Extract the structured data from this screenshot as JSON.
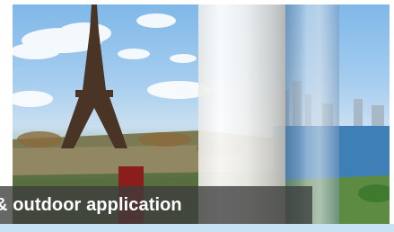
{
  "banner": {
    "caption": "& outdoor application",
    "photo_subject": "eiffel-tower-and-city-skyline-page-curl",
    "colors": {
      "caption_bg": "#3c3c3c",
      "caption_text": "#ffffff",
      "sky": "#8fc2ec",
      "water": "#3f7fb8"
    }
  }
}
